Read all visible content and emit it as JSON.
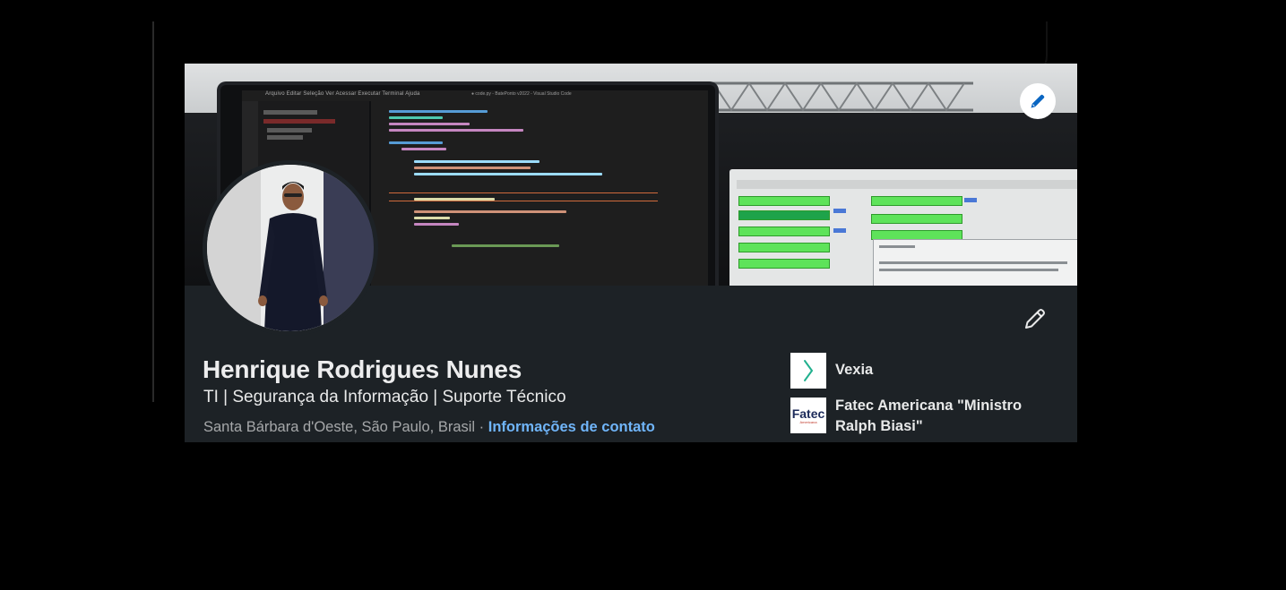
{
  "profile": {
    "name": "Henrique Rodrigues Nunes",
    "headline": "TI | Segurança da Informação | Suporte Técnico",
    "location": "Santa Bárbara d'Oeste, São Paulo, Brasil",
    "separator": " · ",
    "contact_link": "Informações de contato"
  },
  "organizations": [
    {
      "name": "Vexia",
      "logo_icon": "vexia-chevron-icon"
    },
    {
      "name": "Fatec Americana \"Ministro Ralph Biasi\"",
      "logo_text": "Fatec",
      "logo_subtext": "Americana"
    }
  ],
  "cover": {
    "editor_menu": "Arquivo  Editar  Seleção  Ver  Acessar  Executar  Terminal  Ajuda",
    "editor_title": "● code.py - BatePonto v2022 - Visual Studio Code"
  },
  "icons": {
    "cover_edit": "pencil-icon",
    "intro_edit": "pencil-icon"
  },
  "colors": {
    "card_bg": "#1d2226",
    "link": "#70b5f9",
    "edit_button_bg": "#ffffff",
    "edit_icon_blue": "#0a66c2"
  }
}
